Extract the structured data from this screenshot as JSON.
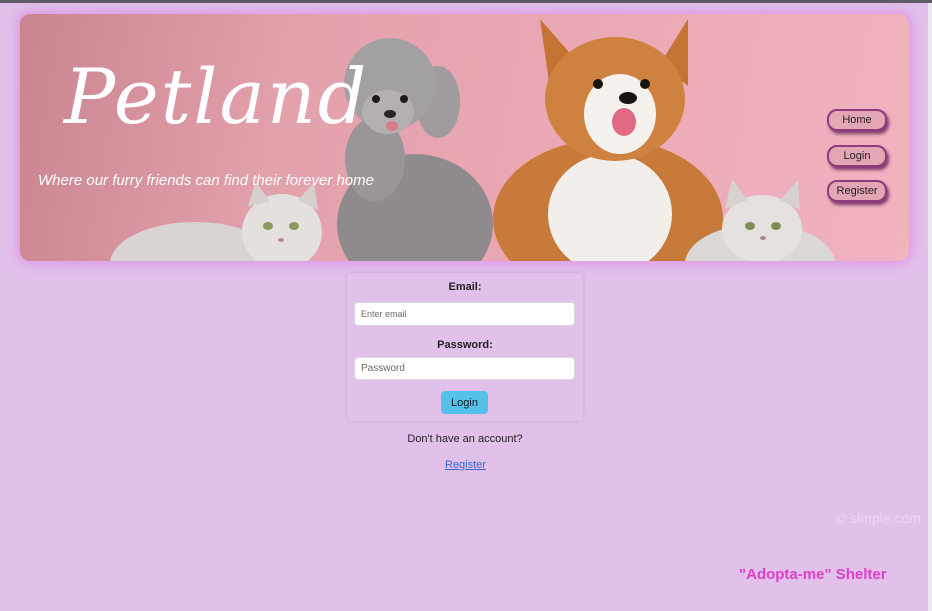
{
  "header": {
    "brand": "Petland",
    "tagline": "Where our furry friends can find their forever home"
  },
  "nav": {
    "items": [
      {
        "label": "Home"
      },
      {
        "label": "Login"
      },
      {
        "label": "Register"
      }
    ]
  },
  "login_form": {
    "email_label": "Email:",
    "email_placeholder": "Enter email",
    "password_label": "Password:",
    "password_placeholder": "Password",
    "submit_label": "Login"
  },
  "signup_prompt": {
    "text": "Don't have an account?",
    "link_label": "Register"
  },
  "watermark": "© simple.com",
  "footer": {
    "shelter_name": "\"Adopta-me\" Shelter"
  },
  "colors": {
    "page_background": "#e1c0ea",
    "banner_pink": "#eba8b4",
    "nav_button": "#e5a6b4",
    "login_button": "#54c1ea",
    "link": "#3b66d6",
    "footer_text": "#dd3fc7"
  }
}
